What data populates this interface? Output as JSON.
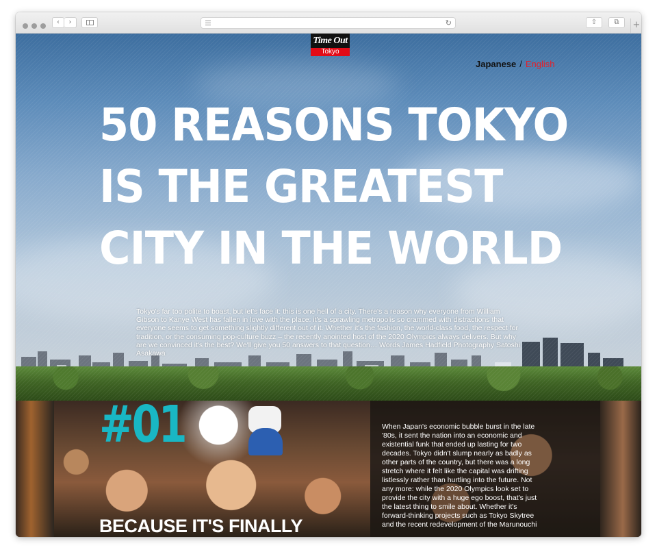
{
  "browser": {
    "nav_back": "‹",
    "nav_forward": "›",
    "reload_icon": "↻",
    "share_icon": "⇧",
    "tabs_icon": "⧉",
    "new_tab": "+"
  },
  "logo": {
    "top": "Time Out",
    "bottom": "Tokyo"
  },
  "language": {
    "japanese": "Japanese",
    "separator": "/",
    "english": "English"
  },
  "hero": {
    "title_lines": [
      "50 REASONS TOKYO",
      "IS THE GREATEST",
      "CITY IN THE WORLD"
    ],
    "intro": "Tokyo's far too polite to boast, but let's face it: this is one hell of a city. There's a reason why everyone from William Gibson to Kanye West has fallen in love with the place: it's a sprawling metropolis so crammed with distractions that everyone seems to get something slightly different out of it. Whether it's the fashion, the world-class food, the respect for tradition, or the consuming pop-culture buzz – the recently anointed host of the 2020 Olympics always delivers. But why are we convinced it's the best? We'll give you 50 answers to that question… Words James Hadfield Photography Satoshi Asakawa"
  },
  "reason": {
    "number": "#01",
    "heading": "BECAUSE IT'S FINALLY",
    "body": "When Japan's economic bubble burst in the late '80s, it sent the nation into an economic and existential funk that ended up lasting for two decades. Tokyo didn't slump nearly as badly as other parts of the country, but there was a long stretch where it felt like the capital was drifting listlessly rather than hurtling into the future. Not any more: while the 2020 Olympics look set to provide the city with a huge ego boost, that's just the latest thing to smile about. Whether it's forward-thinking projects such as Tokyo Skytree and the recent redevelopment of the Marunouchi"
  },
  "colors": {
    "accent_red": "#e3202a",
    "number_teal": "#19b7c4",
    "logo_red": "#e30b17"
  }
}
